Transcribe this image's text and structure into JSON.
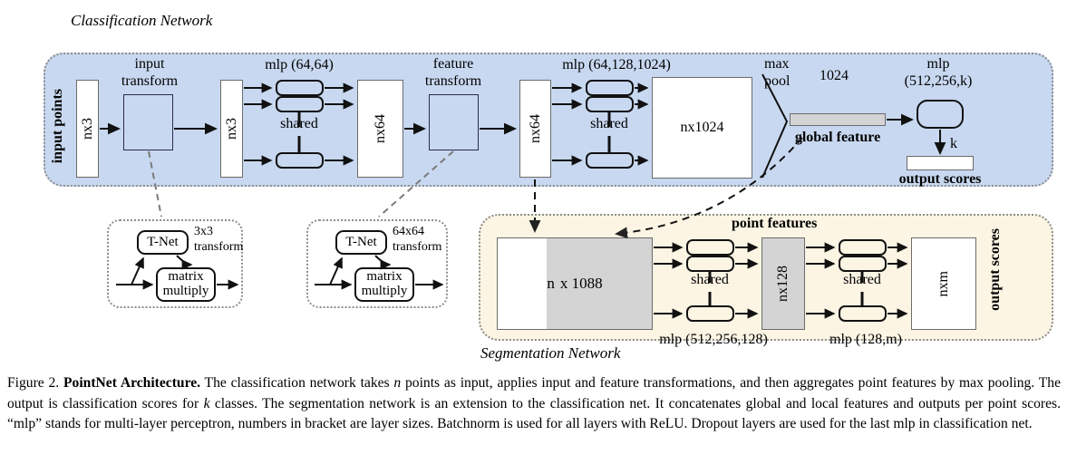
{
  "figure": {
    "classification_network_label": "Classification Network",
    "segmentation_network_label": "Segmentation Network"
  },
  "classification": {
    "input_points_label": "input points",
    "input_tensor": "nx3",
    "input_transform_line1": "input",
    "input_transform_line2": "transform",
    "mlp1_label": "mlp (64,64)",
    "shared1_label": "shared",
    "tensor_nx3": "nx3",
    "tensor_nx64_a": "nx64",
    "feature_transform_line1": "feature",
    "feature_transform_line2": "transform",
    "tensor_nx64_b": "nx64",
    "mlp2_label": "mlp (64,128,1024)",
    "shared2_label": "shared",
    "tensor_nx1024": "nx1024",
    "maxpool_line1": "max",
    "maxpool_line2": "pool",
    "global_feature_size": "1024",
    "global_feature_label": "global feature",
    "mlp3_line1": "mlp",
    "mlp3_line2": "(512,256,k)",
    "k_label": "k",
    "output_scores_label": "output scores"
  },
  "tnet_input": {
    "tnet_label": "T-Net",
    "transform_line1": "3x3",
    "transform_line2": "transform",
    "matmul_line1": "matrix",
    "matmul_line2": "multiply"
  },
  "tnet_feature": {
    "tnet_label": "T-Net",
    "transform_line1": "64x64",
    "transform_line2": "transform",
    "matmul_line1": "matrix",
    "matmul_line2": "multiply"
  },
  "segmentation": {
    "point_features_label": "point features",
    "concat_label_n": "n",
    "concat_label_rest": "x 1088",
    "shared1_label": "shared",
    "shared2_label": "shared",
    "mlp_seg1_label": "mlp (512,256,128)",
    "mlp_seg2_label": "mlp (128,m)",
    "tensor_nx128": "nx128",
    "tensor_nxm": "nxm",
    "output_scores_label": "output scores"
  },
  "caption": {
    "prefix": "Figure 2. ",
    "title": "PointNet Architecture.",
    "body_1": " The classification network takes ",
    "var_n": "n",
    "body_2": " points as input, applies input and feature transformations, and then aggregates point features by max pooling. The output is classification scores for ",
    "var_k": "k",
    "body_3": " classes. The segmentation network is an extension to the classification net. It concatenates global and local features and outputs per point scores. “mlp” stands for multi-layer perceptron, numbers in bracket are layer sizes. Batchnorm is used for all layers with ReLU. Dropout layers are used for the last mlp in classification net."
  },
  "colors": {
    "classification_panel": "#c8d8f0",
    "segmentation_panel": "#fdf5e4",
    "gray_block": "#d4d4d4",
    "outline": "#6b6b6b",
    "stroke": "#111111"
  }
}
